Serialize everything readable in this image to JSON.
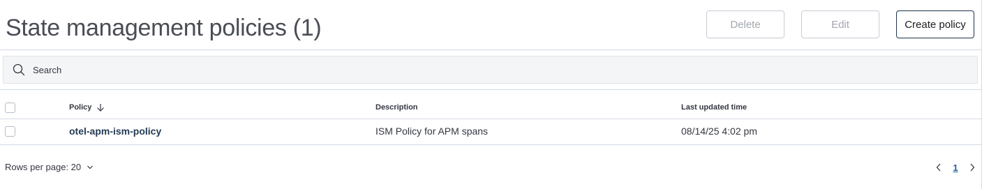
{
  "header": {
    "title": "State management policies (1)",
    "delete_label": "Delete",
    "edit_label": "Edit",
    "create_label": "Create policy"
  },
  "search": {
    "placeholder": "Search"
  },
  "table": {
    "columns": [
      "Policy",
      "Description",
      "Last updated time"
    ],
    "sort_icon": "arrow-down-icon",
    "rows": [
      {
        "policy": "otel-apm-ism-policy",
        "description": "ISM Policy for APM spans",
        "last_updated": "08/14/25 4:02 pm"
      }
    ]
  },
  "footer": {
    "rows_per_page": "Rows per page: 20",
    "current_page": "1"
  },
  "colors": {
    "primary_button_border": "#1f3449",
    "link": "#243b55",
    "page_link": "#1f5f9e"
  }
}
